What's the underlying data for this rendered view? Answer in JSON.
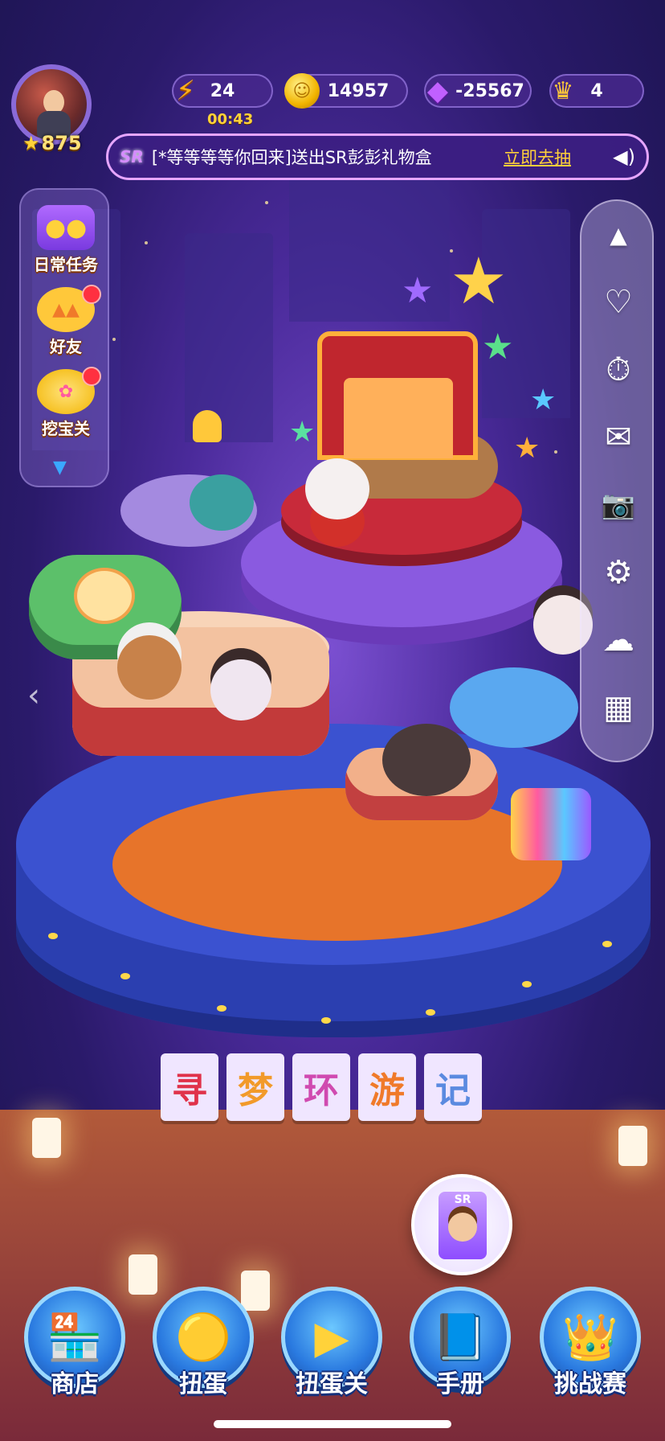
{
  "hud": {
    "player_level": "875",
    "energy": {
      "value": "24",
      "timer": "00:43",
      "icon": "lightning-icon"
    },
    "coins": {
      "value": "14957",
      "icon": "coin-icon"
    },
    "gems": {
      "value": "-25567",
      "icon": "gem-icon"
    },
    "crowns": {
      "value": "4",
      "icon": "crown-icon"
    }
  },
  "announcement": {
    "badge": "SR",
    "text": "[*等等等等你回来]送出SR彭彭礼物盒",
    "link": "立即去抽",
    "icon": "speaker-icon"
  },
  "left_panel": {
    "items": [
      {
        "label": "日常任务",
        "icon": "treasure-chest-icon",
        "badge": false
      },
      {
        "label": "好友",
        "icon": "chicks-icon",
        "badge": true
      },
      {
        "label": "挖宝关",
        "icon": "treasure-pot-icon",
        "badge": true
      }
    ],
    "more_icon": "chevron-down-icon"
  },
  "right_panel": {
    "buttons": [
      {
        "name": "collapse-up",
        "icon": "chevron-up-icon",
        "glyph": "▲"
      },
      {
        "name": "friends-heart",
        "icon": "heart-bubble-icon",
        "glyph": "♡"
      },
      {
        "name": "timer",
        "icon": "stopwatch-icon",
        "glyph": "⏱"
      },
      {
        "name": "mail",
        "icon": "mail-icon",
        "glyph": "✉"
      },
      {
        "name": "camera",
        "icon": "camera-icon",
        "glyph": "📷"
      },
      {
        "name": "settings",
        "icon": "gear-icon",
        "glyph": "⚙"
      },
      {
        "name": "cloud",
        "icon": "cloud-icon",
        "glyph": "☁"
      },
      {
        "name": "calendar",
        "icon": "calendar-icon",
        "glyph": "▦"
      }
    ]
  },
  "scene": {
    "title_chars": [
      "寻",
      "梦",
      "环",
      "游",
      "记"
    ],
    "title_colors": [
      "#e0324a",
      "#f29a2a",
      "#d04ab0",
      "#f07a2a",
      "#5a8ae0"
    ]
  },
  "gacha_bubble": {
    "label": "SR"
  },
  "bottom_nav": [
    {
      "label": "商店",
      "icon": "shop-icon",
      "glyph": "🏪"
    },
    {
      "label": "扭蛋",
      "icon": "gacha-machine-icon",
      "glyph": "🟡"
    },
    {
      "label": "扭蛋关",
      "icon": "gacha-stage-icon",
      "glyph": "▶"
    },
    {
      "label": "手册",
      "icon": "handbook-icon",
      "glyph": "📘"
    },
    {
      "label": "挑战赛",
      "icon": "challenge-crown-icon",
      "glyph": "👑"
    }
  ],
  "colors": {
    "accent_purple": "#8a6ad8",
    "gold": "#ffd23a",
    "link_yellow": "#ffcf3a",
    "nav_blue": "#2a7ae0",
    "notification_red": "#ff3040"
  }
}
